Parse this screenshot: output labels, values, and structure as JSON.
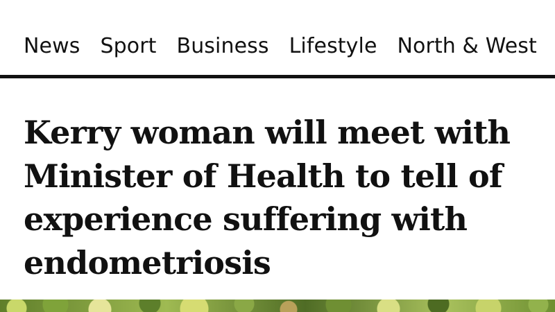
{
  "nav": {
    "items": [
      {
        "label": "News"
      },
      {
        "label": "Sport"
      },
      {
        "label": "Business"
      },
      {
        "label": "Lifestyle"
      },
      {
        "label": "North & West"
      }
    ]
  },
  "article": {
    "headline": "Kerry woman will meet with Minister of Health to tell of experience suffering with endometriosis"
  },
  "colors": {
    "text": "#111111",
    "background": "#ffffff",
    "rule": "#111111"
  }
}
